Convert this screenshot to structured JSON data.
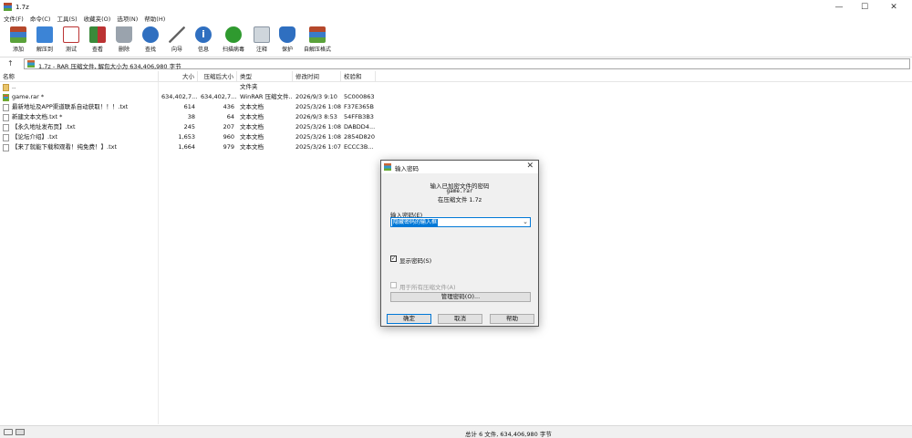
{
  "window": {
    "title": "1.7z",
    "minimize_glyph": "—",
    "maximize_glyph": "☐",
    "close_glyph": "✕"
  },
  "menu": [
    "文件(F)",
    "命令(C)",
    "工具(S)",
    "收藏夹(O)",
    "选项(N)",
    "帮助(H)"
  ],
  "toolbar": {
    "add": "添加",
    "extract": "解压到",
    "test": "测试",
    "view": "查看",
    "delete": "删除",
    "find": "查找",
    "wizard": "向导",
    "info": "信息",
    "virus_scan": "扫描病毒",
    "comment": "注释",
    "protect": "保护",
    "sfx": "自解压格式"
  },
  "address": {
    "up_glyph": "↑",
    "path": "1.7z - RAR 压缩文件, 解包大小为 634,406,980 字节"
  },
  "columns": {
    "name": "名称",
    "size": "大小",
    "packed": "压缩后大小",
    "type": "类型",
    "modified": "修改时间",
    "crc": "校验和"
  },
  "files": [
    {
      "name": "..",
      "size": "",
      "packed": "",
      "type": "文件夹",
      "modified": "",
      "crc": "",
      "icon": "folder"
    },
    {
      "name": "game.rar *",
      "size": "634,402,7...",
      "packed": "634,402,7...",
      "type": "WinRAR 压缩文件...",
      "modified": "2026/9/3 9:10",
      "crc": "5C000863",
      "icon": "rar"
    },
    {
      "name": "最新地址及APP渠道联系自动获取！！！.txt",
      "size": "614",
      "packed": "436",
      "type": "文本文档",
      "modified": "2025/3/26 1:08",
      "crc": "F37E365B",
      "icon": "txt"
    },
    {
      "name": "新建文本文档.txt *",
      "size": "38",
      "packed": "64",
      "type": "文本文档",
      "modified": "2026/9/3 8:53",
      "crc": "54FFB3B3",
      "icon": "txt"
    },
    {
      "name": "【永久地址发布页】.txt",
      "size": "245",
      "packed": "207",
      "type": "文本文档",
      "modified": "2025/3/26 1:08",
      "crc": "DABDD4...",
      "icon": "txt"
    },
    {
      "name": "【论坛介绍】.txt",
      "size": "1,653",
      "packed": "960",
      "type": "文本文档",
      "modified": "2025/3/26 1:08",
      "crc": "2854D820",
      "icon": "txt"
    },
    {
      "name": "【来了就能下载和观看！纯免费！】.txt",
      "size": "1,664",
      "packed": "979",
      "type": "文本文档",
      "modified": "2025/3/26 1:07",
      "crc": "ECCC3B...",
      "icon": "txt"
    }
  ],
  "status": {
    "text": "总计 6 文件, 634,406,980 字节"
  },
  "dialog": {
    "title": "输入密码",
    "close_glyph": "✕",
    "heading": "输入已加密文件的密码",
    "filename": "game.rar",
    "in_archive": "在压缩文件 1.7z",
    "password_label": "输入密码(E)",
    "password_value": "隐藏密码的输入框",
    "dropdown_glyph": "⌄",
    "show_password_label": "显示密码(S)",
    "show_password_checked": "✓",
    "use_for_all_label": "用于所有压缩文件(A)",
    "manage_button": "管理密码(O)...",
    "ok_button": "确定",
    "cancel_button": "取消",
    "help_button": "帮助"
  }
}
